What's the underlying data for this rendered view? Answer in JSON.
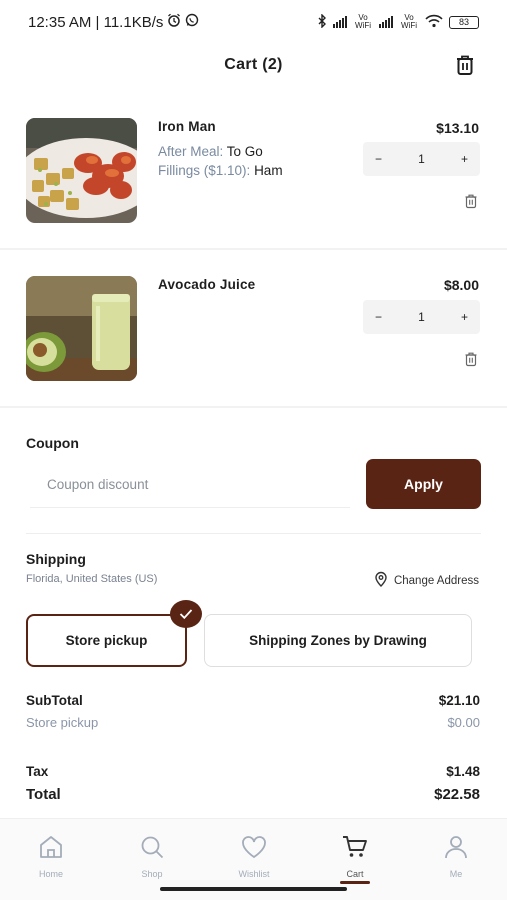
{
  "status_bar": {
    "time_speed": "12:35 AM | 11.1KB/s",
    "vo_wifi_1": "Vo WiFi",
    "vo_wifi_2": "Vo WiFi",
    "battery": "83"
  },
  "header": {
    "title": "Cart (2)"
  },
  "items": [
    {
      "name": "Iron Man",
      "price": "$13.10",
      "quantity": "1",
      "options": [
        {
          "label": "After Meal:",
          "value": "To Go"
        },
        {
          "label": "Fillings ($1.10):",
          "value": "Ham"
        }
      ]
    },
    {
      "name": "Avocado Juice",
      "price": "$8.00",
      "quantity": "1",
      "options": []
    }
  ],
  "stepper": {
    "minus": "−",
    "plus": "+"
  },
  "coupon": {
    "label": "Coupon",
    "placeholder": "Coupon discount",
    "apply_label": "Apply"
  },
  "shipping": {
    "label": "Shipping",
    "location": "Florida, United States (US)",
    "change_address": "Change Address",
    "options": [
      "Store pickup",
      "Shipping Zones by Drawing"
    ],
    "selected": "Store pickup"
  },
  "summary": {
    "subtotal_label": "SubTotal",
    "subtotal_value": "$21.10",
    "method_label": "Store pickup",
    "method_value": "$0.00",
    "tax_label": "Tax",
    "tax_value": "$1.48",
    "total_label": "Total",
    "total_value": "$22.58"
  },
  "nav": {
    "items": [
      "Home",
      "Shop",
      "Wishlist",
      "Cart",
      "Me"
    ],
    "active": "Cart"
  },
  "colors": {
    "accent": "#5a2414",
    "muted_text": "#7a8aa0",
    "stepper_bg": "#f3f3f3"
  }
}
